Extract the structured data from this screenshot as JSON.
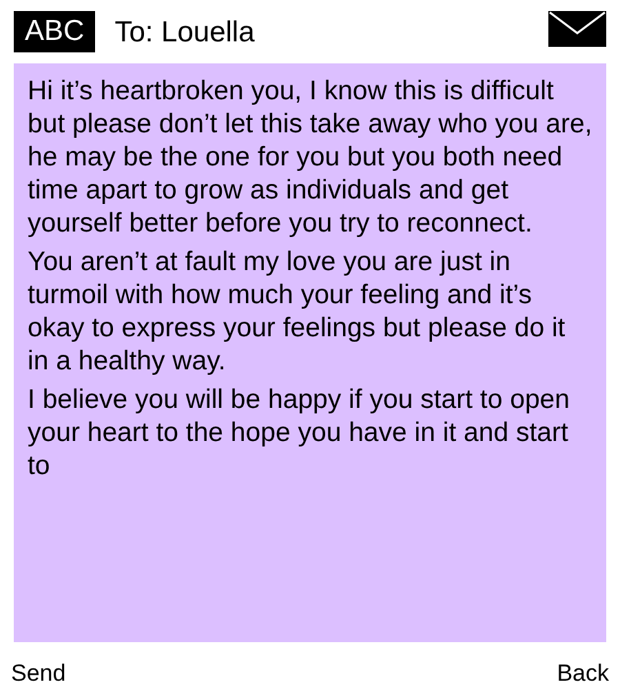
{
  "header": {
    "input_mode": "ABC",
    "recipient": "To: Louella"
  },
  "message": {
    "paragraphs": [
      "Hi it’s heartbroken you, I know this is difficult but please don’t let this take away who you are, he may be the one for you but you both need time apart to grow as individuals and get yourself better before you try to reconnect.",
      "You aren’t at fault my love you are just in turmoil with how much your feeling and it’s okay to express your feelings but please do it in a healthy way.",
      "I believe you will be happy if you start to open your heart to the hope you have in it and start to"
    ]
  },
  "softkeys": {
    "left": "Send",
    "right": "Back"
  }
}
